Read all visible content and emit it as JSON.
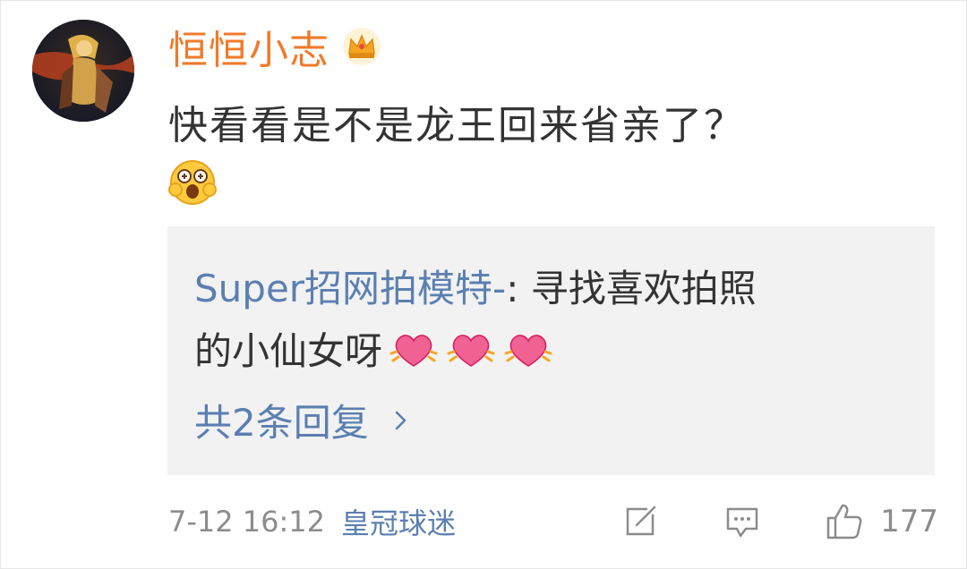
{
  "comment": {
    "username": "恒恒小志",
    "user_badge_icon": "crown-icon",
    "text": "快看看是不是龙王回来省亲了？",
    "emoji": "wow-face-emoji"
  },
  "reply_preview": {
    "author": "Super招网拍模特-",
    "separator": ": ",
    "text_line1": "寻找喜欢拍照",
    "text_line2": "的小仙女呀",
    "emoji": "beating-heart-emoji",
    "emoji_count": 3,
    "more_label": "共2条回复"
  },
  "footer": {
    "timestamp": "7-12 16:12",
    "badge": "皇冠球迷",
    "like_count": "177",
    "icons": [
      "edit-icon",
      "comment-icon",
      "thumbs-up-icon"
    ]
  },
  "colors": {
    "username": "#f07a2a",
    "link_blue": "#5b7fb1",
    "text": "#333333",
    "meta_gray": "#8c8c8c",
    "reply_bg": "#f2f2f2"
  }
}
